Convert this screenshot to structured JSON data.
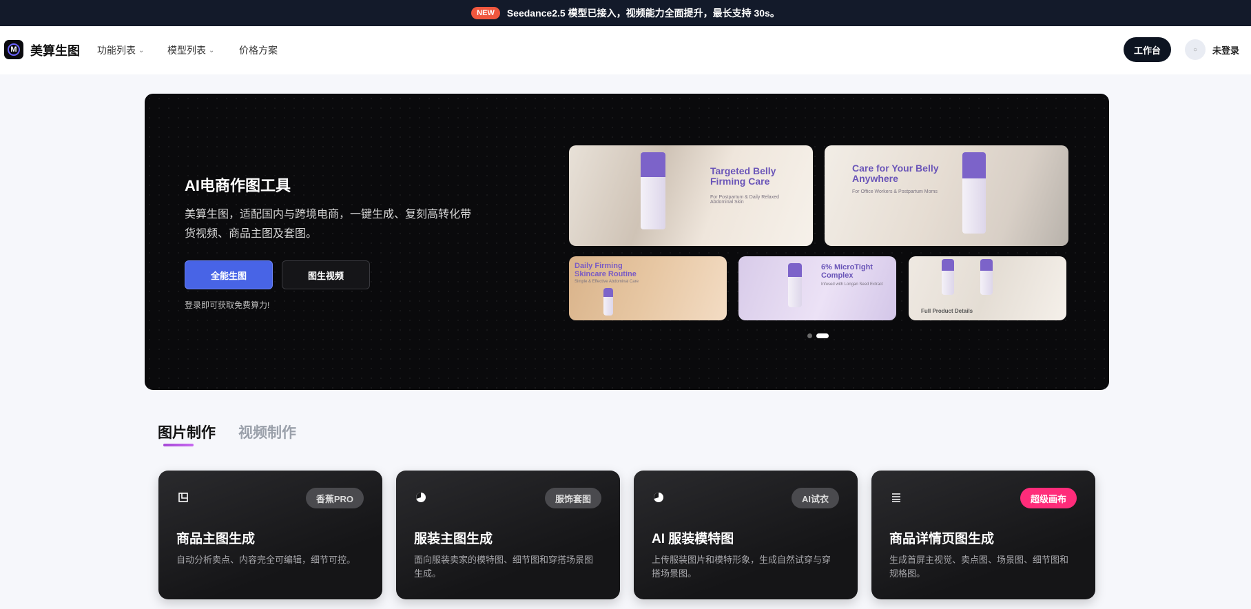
{
  "announcement": {
    "badge": "NEW",
    "text": "Seedance2.5 模型已接入，视频能力全面提升，最长支持 30s。"
  },
  "header": {
    "logo_letter": "M",
    "brand": "美算生图",
    "nav": [
      {
        "label": "功能列表",
        "has_dropdown": true
      },
      {
        "label": "模型列表",
        "has_dropdown": true
      },
      {
        "label": "价格方案",
        "has_dropdown": false
      }
    ],
    "workspace_label": "工作台",
    "login_label": "未登录"
  },
  "hero": {
    "title": "AI电商作图工具",
    "description": "美算生图，适配国内与跨境电商，一键生成、复刻高转化带货视频、商品主图及套图。",
    "primary_button": "全能生图",
    "secondary_button": "图生视频",
    "note": "登录即可获取免费算力!",
    "carousel_active": 2,
    "carousel_total": 2,
    "thumbnails": [
      {
        "title": "Targeted Belly Firming Care",
        "subtitle": "For Postpartum & Daily Relaxed Abdominal Skin"
      },
      {
        "title": "Care for Your Belly Anywhere",
        "subtitle": "For Office Workers & Postpartum Moms"
      },
      {
        "title": "Daily Firming Skincare Routine",
        "subtitle": "Simple & Effective Abdominal Care"
      },
      {
        "title": "6% MicroTight Complex",
        "subtitle": "Infused with Longan Seed Extract"
      },
      {
        "title": "Full Product Details",
        "subtitle": ""
      }
    ]
  },
  "tabs": [
    {
      "label": "图片制作",
      "active": true
    },
    {
      "label": "视频制作",
      "active": false
    }
  ],
  "cards": [
    {
      "icon": "image-layout-icon",
      "badge": "香蕉PRO",
      "badge_color": "#4a4a4e",
      "title": "商品主图生成",
      "desc": "自动分析卖点、内容完全可编辑，细节可控。"
    },
    {
      "icon": "pie-icon",
      "badge": "服饰套图",
      "badge_color": "#4a4a4e",
      "title": "服装主图生成",
      "desc": "面向服装卖家的模特图、细节图和穿搭场景图生成。"
    },
    {
      "icon": "pie-icon",
      "badge": "AI试衣",
      "badge_color": "#4a4a4e",
      "title": "AI 服装模特图",
      "desc": "上传服装图片和模特形象，生成自然试穿与穿搭场景图。"
    },
    {
      "icon": "list-icon",
      "badge": "超级画布",
      "badge_color": "#ff2c7a",
      "title": "商品详情页图生成",
      "desc": "生成首屏主视觉、卖点图、场景图、细节图和规格图。"
    }
  ],
  "colors": {
    "accent": "#4864e6",
    "dark": "#131a2a",
    "pink": "#ff2c7a",
    "purple": "#a64ad6"
  }
}
